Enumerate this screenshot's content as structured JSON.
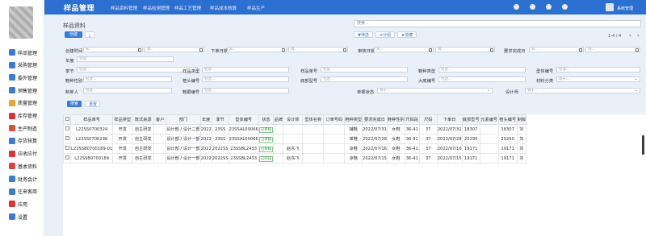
{
  "app": {
    "title": "样品管理",
    "nav": [
      "样品资料管理",
      "样品检测管理",
      "样品工艺管理",
      "样品成本核算",
      "样品生产"
    ],
    "user": "系统管理"
  },
  "sidebar": [
    {
      "label": "样品管理",
      "color": "#3a7bd5"
    },
    {
      "label": "采购管理",
      "color": "#3a7bd5"
    },
    {
      "label": "委外管理",
      "color": "#3a7bd5"
    },
    {
      "label": "销售管理",
      "color": "#3a7bd5"
    },
    {
      "label": "质量管理",
      "color": "#f0a030"
    },
    {
      "label": "库存管理",
      "color": "#e03030"
    },
    {
      "label": "生产制造",
      "color": "#e05030"
    },
    {
      "label": "存货核算",
      "color": "#3a7bd5"
    },
    {
      "label": "应收应付",
      "color": "#e03030"
    },
    {
      "label": "基本资料",
      "color": "#e04040"
    },
    {
      "label": "财务会计",
      "color": "#3a7bd5"
    },
    {
      "label": "往来客商",
      "color": "#3a7bd5"
    },
    {
      "label": "应用",
      "color": "#e03030"
    },
    {
      "label": "设置",
      "color": "#3a7bd5"
    }
  ],
  "page": {
    "title": "样品资料",
    "create": "创建",
    "search_placeholder": "搜索...",
    "filter": "▼筛选",
    "group": "≡分组",
    "favorite": "★收藏",
    "pager": "1-4 / 4",
    "prev": "‹",
    "next": "›"
  },
  "form": {
    "created_label": "创建时间",
    "from": "从..",
    "to": "到..",
    "year_label": "年度",
    "year_ph": "包含..",
    "order_date_label": "下单日期",
    "review_date_label": "审核日期",
    "due_label": "要求完成日",
    "contains": "包含...",
    "equals": "等于...",
    "season": "季节",
    "sample_type": "样品类型",
    "sample_no": "样品单号",
    "shoe_type": "鞋种类型",
    "model_no": "型体编号",
    "shoe_gender": "鞋种性别",
    "last_type": "楦头编号",
    "sole_type": "底部型号",
    "main_category": "大底编号",
    "material_cat": "材料分类",
    "heel_no": "鞋跟编号",
    "doc_status": "单据状态",
    "maker": "制单人",
    "designer": "设计师",
    "search_btn": "搜索",
    "reset_btn": "重置"
  },
  "table": {
    "headers": [
      "样品单号",
      "样品类型",
      "款式来源",
      "客户",
      "部门",
      "年度",
      "季节",
      "型体编号",
      "状态",
      "品牌",
      "设计师",
      "型体名称",
      "订单号码",
      "鞋种类型",
      "要求完成日",
      "鞋种性别",
      "尺码段",
      "尺码",
      "下单日",
      "底部型号",
      "元素编号",
      "楦头编号",
      "制版"
    ],
    "rows": [
      [
        "L22SS0700324",
        "开发",
        "自主研发",
        "",
        "设计部 / 设计二部",
        "2022",
        "23SS",
        "23SSAL00066",
        "已审核",
        "",
        "",
        "",
        "",
        "辅鞋",
        "2022/07/31",
        "女鞋",
        "36-41",
        "37",
        "2022/07/31",
        "18307",
        "",
        "18307",
        "刘"
      ],
      [
        "L22SS0700298",
        "开发",
        "自主研发",
        "",
        "设计部 / 设计一部",
        "2022",
        "23SS",
        "23SSAL00066",
        "已审核",
        "",
        "",
        "",
        "",
        "单鞋",
        "2022/07/28",
        "女鞋",
        "36-41",
        "37",
        "2022/07/28",
        "20290",
        "",
        "20290",
        "刘"
      ],
      [
        "L22SSB0700189-01",
        "开发",
        "自主研发",
        "",
        "设计部 / 设计一部",
        "2022",
        "2022SS",
        "23SSBL2433",
        "已审核",
        "",
        "赵东飞",
        "",
        "",
        "凉鞋",
        "2022/07/16",
        "女鞋",
        "36-41",
        "37",
        "2022/07/16",
        "19171",
        "",
        "19171",
        "刘"
      ],
      [
        "L22SSB0700189",
        "开发",
        "自主研发",
        "",
        "设计部 / 设计一部",
        "2022",
        "2022SS",
        "23SSBL2433",
        "已完成",
        "",
        "赵东飞",
        "",
        "",
        "凉鞋",
        "2022/07/15",
        "女鞋",
        "36-41",
        "37",
        "2022/07/15",
        "19171",
        "",
        "19171",
        "刘"
      ]
    ]
  }
}
